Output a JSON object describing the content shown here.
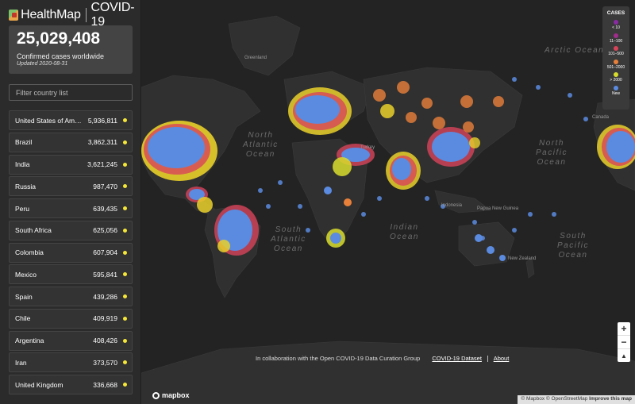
{
  "brand": {
    "name": "HealthMap",
    "section": "COVID-19"
  },
  "stats": {
    "total": "25,029,408",
    "label": "Confirmed cases worldwide",
    "updated": "Updated 2020-08-31"
  },
  "filter": {
    "placeholder": "Filter country list"
  },
  "countries": [
    {
      "name": "United States of Amer...",
      "cases": "5,936,811"
    },
    {
      "name": "Brazil",
      "cases": "3,862,311"
    },
    {
      "name": "India",
      "cases": "3,621,245"
    },
    {
      "name": "Russia",
      "cases": "987,470"
    },
    {
      "name": "Peru",
      "cases": "639,435"
    },
    {
      "name": "South Africa",
      "cases": "625,056"
    },
    {
      "name": "Colombia",
      "cases": "607,904"
    },
    {
      "name": "Mexico",
      "cases": "595,841"
    },
    {
      "name": "Spain",
      "cases": "439,286"
    },
    {
      "name": "Chile",
      "cases": "409,919"
    },
    {
      "name": "Argentina",
      "cases": "408,426"
    },
    {
      "name": "Iran",
      "cases": "373,570"
    },
    {
      "name": "United Kingdom",
      "cases": "336,668"
    }
  ],
  "legend": {
    "title": "CASES",
    "items": [
      {
        "label": "< 10",
        "color": "#8a2ba3"
      },
      {
        "label": "11–100",
        "color": "#a02c8c"
      },
      {
        "label": "101–500",
        "color": "#d8435a"
      },
      {
        "label": "501–2000",
        "color": "#e9803a"
      },
      {
        "label": "> 2000",
        "color": "#d8dd2d"
      },
      {
        "label": "New",
        "color": "#5b8be0"
      }
    ]
  },
  "map_labels": {
    "arctic": "Arctic Ocean",
    "north_atlantic": [
      "North",
      "Atlantic",
      "Ocean"
    ],
    "south_atlantic": [
      "South",
      "Atlantic",
      "Ocean"
    ],
    "indian": [
      "Indian",
      "Ocean"
    ],
    "north_pacific": [
      "North",
      "Pacific",
      "Ocean"
    ],
    "south_pacific": [
      "South",
      "Pacific",
      "Ocean"
    ],
    "greenland": "Greenland",
    "canada": "Canada",
    "indonesia": "Indonesia",
    "papua": "Papua New Guinea",
    "new_zealand": "New Zealand",
    "turkey": "Turkey"
  },
  "zoom": {
    "in": "+",
    "out": "−",
    "compass": "▲"
  },
  "footer": {
    "collab": "In collaboration with the Open COVID-19 Data Curation Group",
    "dataset_link": "COVID-19 Dataset",
    "about_link": "About",
    "mapbox": "mapbox",
    "attribution": "© Mapbox © OpenStreetMap",
    "improve": "Improve this map"
  }
}
